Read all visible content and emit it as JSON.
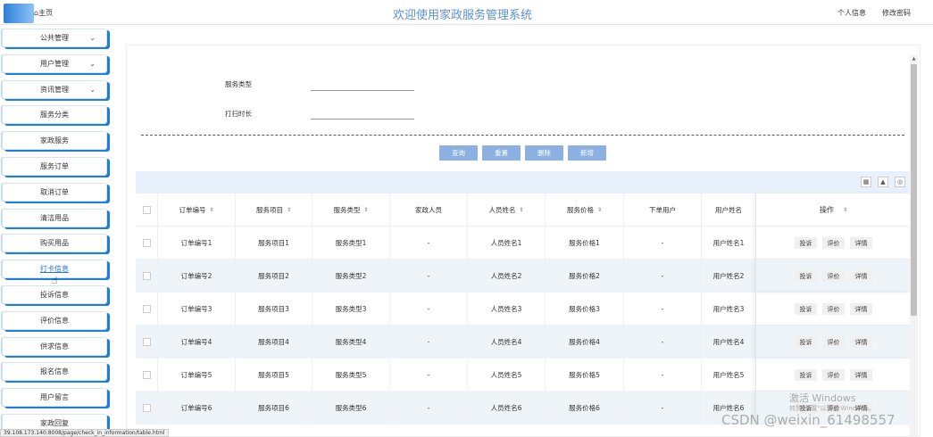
{
  "header": {
    "home_label": "主页",
    "title": "欢迎使用家政服务管理系统",
    "profile_label": "个人信息",
    "change_password_label": "修改密码"
  },
  "sidebar": {
    "items": [
      {
        "label": "公共管理",
        "has_chevron": true
      },
      {
        "label": "用户管理",
        "has_chevron": true
      },
      {
        "label": "资讯管理",
        "has_chevron": true
      },
      {
        "label": "服务分类"
      },
      {
        "label": "家政服务"
      },
      {
        "label": "服务订单"
      },
      {
        "label": "取消订单"
      },
      {
        "label": "清洁用品"
      },
      {
        "label": "购买用品"
      },
      {
        "label": "打卡信息",
        "active": true
      },
      {
        "label": "投诉信息"
      },
      {
        "label": "评价信息"
      },
      {
        "label": "供求信息"
      },
      {
        "label": "报名信息"
      },
      {
        "label": "用户留言"
      },
      {
        "label": "家政回复"
      }
    ]
  },
  "filters": {
    "service_type_label": "服务类型",
    "clock_time_label": "打扫时长"
  },
  "buttons": {
    "query": "查询",
    "reset": "重置",
    "delete": "删除",
    "add": "新增"
  },
  "table": {
    "headers": [
      "订单编号",
      "服务项目",
      "服务类型",
      "家政人员",
      "人员姓名",
      "服务价格",
      "下单用户",
      "用户姓名",
      "操作"
    ],
    "rows": [
      [
        "订单编号1",
        "服务项目1",
        "服务类型1",
        "-",
        "人员姓名1",
        "服务价格1",
        "-",
        "用户姓名1"
      ],
      [
        "订单编号2",
        "服务项目2",
        "服务类型2",
        "-",
        "人员姓名2",
        "服务价格2",
        "-",
        "用户姓名2"
      ],
      [
        "订单编号3",
        "服务项目3",
        "服务类型3",
        "-",
        "人员姓名3",
        "服务价格3",
        "-",
        "用户姓名3"
      ],
      [
        "订单编号4",
        "服务项目4",
        "服务类型4",
        "-",
        "人员姓名4",
        "服务价格4",
        "-",
        "用户姓名4"
      ],
      [
        "订单编号5",
        "服务项目5",
        "服务类型5",
        "-",
        "人员姓名5",
        "服务价格5",
        "-",
        "用户姓名5"
      ],
      [
        "订单编号6",
        "服务项目6",
        "服务类型6",
        "-",
        "人员姓名6",
        "服务价格6",
        "-",
        "用户姓名6"
      ]
    ],
    "row_actions": [
      "投诉",
      "评价",
      "详情"
    ]
  },
  "status_url": "39.108.173.140:8008/page/check_in_information/table.html",
  "watermark": {
    "activate": "激活 Windows",
    "activate_sub": "转到\"设置\"以激活 Windows。",
    "csdn": "CSDN @weixin_61498557"
  },
  "colors": {
    "accent_blue": "#1e7fd8",
    "button_blue": "#8cb0df",
    "title_blue": "#5b8fd6"
  }
}
